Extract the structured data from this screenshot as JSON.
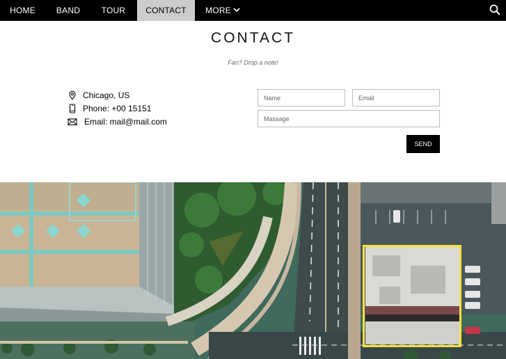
{
  "nav": {
    "items": [
      {
        "label": "HOME"
      },
      {
        "label": "BAND"
      },
      {
        "label": "TOUR"
      },
      {
        "label": "CONTACT"
      },
      {
        "label": "MORE"
      }
    ],
    "search_icon": "search-icon",
    "more_icon": "chevron-down-icon"
  },
  "contact": {
    "title": "CONTACT",
    "subtitle": "Fan? Drop a note!",
    "location": "Chicago, US",
    "phone": "Phone: +00 15151",
    "email": "Email: mail@mail.com",
    "form": {
      "name_placeholder": "Name",
      "email_placeholder": "Email",
      "message_placeholder": "Massage",
      "send_label": "SEND"
    }
  },
  "colors": {
    "nav_bg": "#000000",
    "nav_active_bg": "#cccccc",
    "button_bg": "#000000",
    "highlight": "#f5e33b"
  }
}
